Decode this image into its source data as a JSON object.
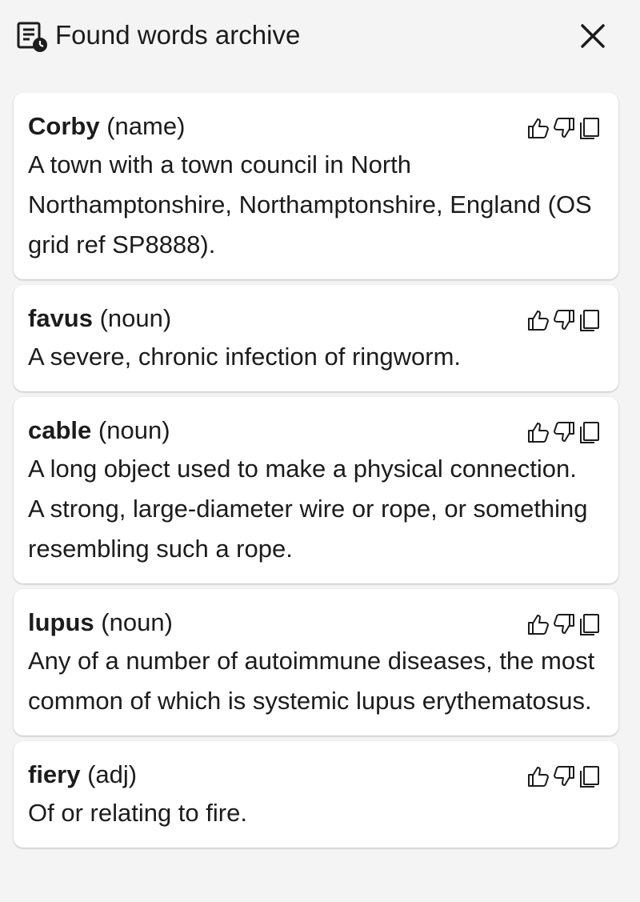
{
  "header": {
    "title": "Found words archive"
  },
  "entries": [
    {
      "word": "Corby",
      "pos": "(name)",
      "definition": "A town with a town council in North Northamptonshire, Northamptonshire, England (OS grid ref SP8888)."
    },
    {
      "word": "favus",
      "pos": "(noun)",
      "definition": "A severe, chronic infection of ringworm."
    },
    {
      "word": "cable",
      "pos": "(noun)",
      "definition": "A long object used to make a physical connection. A strong, large-diameter wire or rope, or something resembling such a rope."
    },
    {
      "word": "lupus",
      "pos": "(noun)",
      "definition": "Any of a number of autoimmune diseases, the most common of which is systemic lupus erythematosus."
    },
    {
      "word": "fiery",
      "pos": "(adj)",
      "definition": "Of or relating to fire."
    }
  ],
  "icons": {
    "header": "archive-history-icon",
    "close": "close-icon",
    "like": "thumbs-up-icon",
    "dislike": "thumbs-down-icon",
    "copy": "copy-icon"
  },
  "colors": {
    "background": "#f4f4f4",
    "card": "#ffffff",
    "text": "#1c1c1c"
  }
}
